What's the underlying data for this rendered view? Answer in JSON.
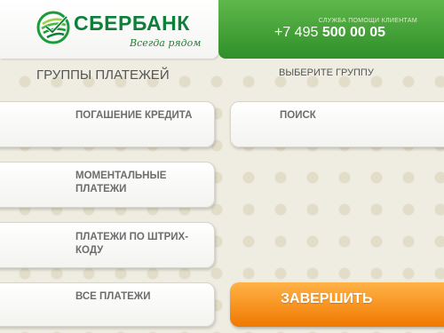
{
  "header": {
    "brand_name": "СБЕРБАНК",
    "slogan": "Всегда рядом",
    "support_label": "СЛУЖБА ПОМОЩИ КЛИЕНТАМ",
    "phone_prefix": "+7 495 ",
    "phone_number": "500 00 05"
  },
  "main": {
    "title": "ГРУППЫ ПЛАТЕЖЕЙ",
    "hint": "ВЫБЕРИТЕ ГРУППУ",
    "left_buttons": [
      {
        "line1": "ПОГАШЕНИЕ КРЕДИТА",
        "line2": ""
      },
      {
        "line1": "МОМЕНТАЛЬНЫЕ",
        "line2": "ПЛАТЕЖИ"
      },
      {
        "line1": "ПЛАТЕЖИ ПО ШТРИХ-",
        "line2": "КОДУ"
      },
      {
        "line1": "ВСЕ ПЛАТЕЖИ",
        "line2": ""
      }
    ],
    "search_button": "ПОИСК",
    "finish_button": "ЗАВЕРШИТЬ"
  },
  "colors": {
    "brand_green": "#0e7f3a",
    "support_green": "#3d9a32",
    "finish_orange": "#f58a10",
    "background": "#efece1"
  }
}
